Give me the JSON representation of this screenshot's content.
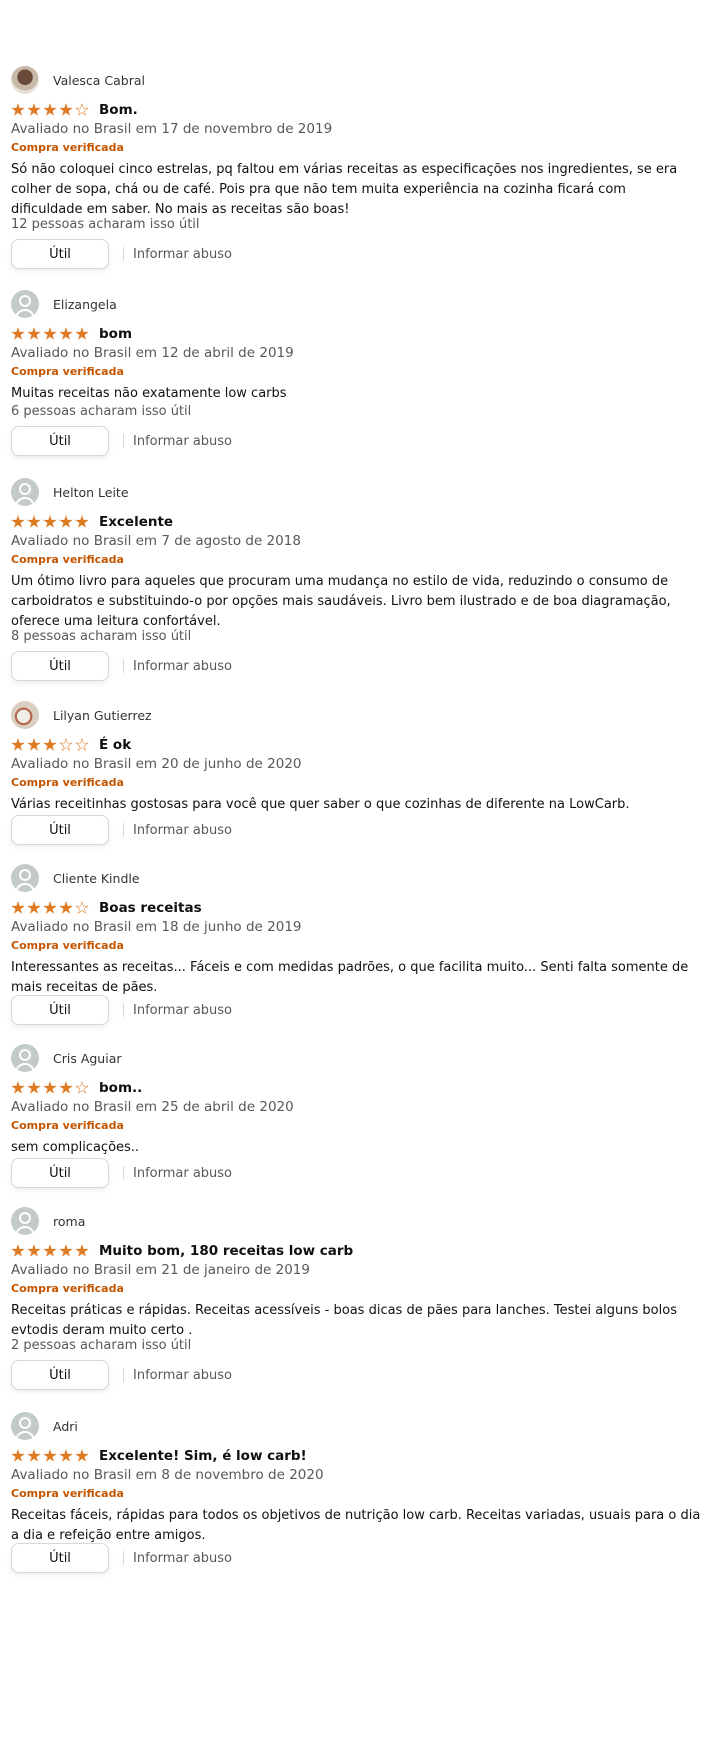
{
  "reviews": [
    {
      "name": "Valesca Cabral",
      "avatar_icon": "user-photo",
      "rating": 4,
      "title": "Bom.",
      "date": "Avaliado no Brasil em 17 de novembro de 2019",
      "verified": "Compra verificada",
      "text": "Só não coloquei cinco estrelas, pq faltou em várias receitas as especificações nos ingredientes, se era colher de sopa, chá ou de café. Pois pra que não tem muita experiência na cozinha ficará com dificuldade em saber. No mais as receitas são boas!",
      "helpful": "12 pessoas acharam isso útil",
      "useful_label": "Útil",
      "report_label": "Informar abuso"
    },
    {
      "name": "Elizangela",
      "avatar_icon": "default-user",
      "rating": 5,
      "title": "bom",
      "date": "Avaliado no Brasil em 12 de abril de 2019",
      "verified": "Compra verificada",
      "text": "Muitas receitas não exatamente low carbs",
      "helpful": "6 pessoas acharam isso útil",
      "useful_label": "Útil",
      "report_label": "Informar abuso"
    },
    {
      "name": "Helton Leite",
      "avatar_icon": "default-user",
      "rating": 5,
      "title": "Excelente",
      "date": "Avaliado no Brasil em 7 de agosto de 2018",
      "verified": "Compra verificada",
      "text": "Um ótimo livro para aqueles que procuram uma mudança no estilo de vida, reduzindo o consumo de carboidratos e substituindo-o por opções mais saudáveis. Livro bem ilustrado e de boa diagramação, oferece uma leitura confortável.",
      "helpful": "8 pessoas acharam isso útil",
      "useful_label": "Útil",
      "report_label": "Informar abuso"
    },
    {
      "name": "Lilyan Gutierrez",
      "avatar_icon": "user-photo",
      "rating": 3,
      "title": "É ok",
      "date": "Avaliado no Brasil em 20 de junho de 2020",
      "verified": "Compra verificada",
      "text": "Várias receitinhas gostosas para você que quer saber o que cozinhas de diferente na LowCarb.",
      "helpful": "",
      "useful_label": "Útil",
      "report_label": "Informar abuso"
    },
    {
      "name": "Cliente Kindle",
      "avatar_icon": "default-user",
      "rating": 4,
      "title": "Boas receitas",
      "date": "Avaliado no Brasil em 18 de junho de 2019",
      "verified": "Compra verificada",
      "text": "Interessantes as receitas... Fáceis e com medidas padrões, o que facilita muito... Senti falta somente de mais receitas de pães.",
      "helpful": "",
      "useful_label": "Útil",
      "report_label": "Informar abuso"
    },
    {
      "name": "Cris Aguiar",
      "avatar_icon": "default-user",
      "rating": 4,
      "title": "bom..",
      "date": "Avaliado no Brasil em 25 de abril de 2020",
      "verified": "Compra verificada",
      "text": "sem complicações..",
      "helpful": "",
      "useful_label": "Útil",
      "report_label": "Informar abuso"
    },
    {
      "name": "roma",
      "avatar_icon": "default-user",
      "rating": 5,
      "title": "Muito bom, 180 receitas low carb",
      "date": "Avaliado no Brasil em 21 de janeiro de 2019",
      "verified": "Compra verificada",
      "text": "Receitas práticas e rápidas. Receitas acessíveis - boas dicas de pães para lanches. Testei alguns bolos evtodis deram muito certo .",
      "helpful": "2 pessoas acharam isso útil",
      "useful_label": "Útil",
      "report_label": "Informar abuso"
    },
    {
      "name": "Adri",
      "avatar_icon": "default-user",
      "rating": 5,
      "title": "Excelente! Sim, é low carb!",
      "date": "Avaliado no Brasil em 8 de novembro de 2020",
      "verified": "Compra verificada",
      "text": "Receitas fáceis, rápidas para todos os objetivos de nutrição low carb. Receitas variadas, usuais para o dia a dia e refeição entre amigos.",
      "helpful": "",
      "useful_label": "Útil",
      "report_label": "Informar abuso"
    }
  ]
}
